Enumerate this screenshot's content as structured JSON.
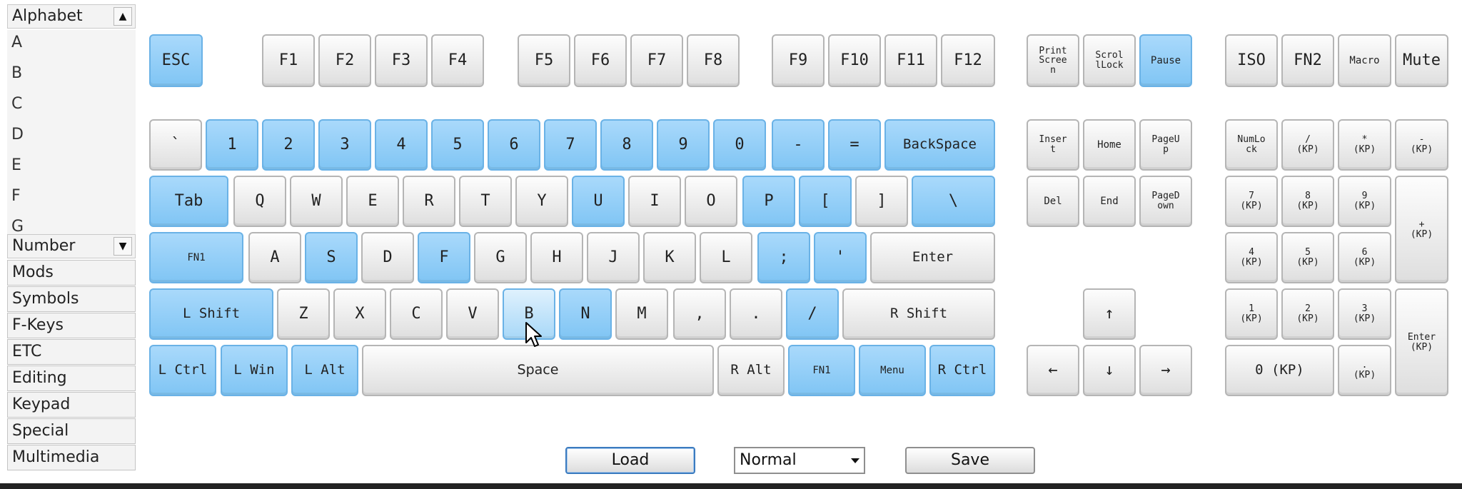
{
  "categories": {
    "alphabet_header": "Alphabet",
    "alphabet_items": [
      "A",
      "B",
      "C",
      "D",
      "E",
      "F",
      "G"
    ],
    "number_header": "Number",
    "items": [
      "Mods",
      "Symbols",
      "F-Keys",
      "ETC",
      "Editing",
      "Keypad",
      "Special",
      "Multimedia"
    ]
  },
  "keys": {
    "esc": "ESC",
    "f1": "F1",
    "f2": "F2",
    "f3": "F3",
    "f4": "F4",
    "f5": "F5",
    "f6": "F6",
    "f7": "F7",
    "f8": "F8",
    "f9": "F9",
    "f10": "F10",
    "f11": "F11",
    "f12": "F12",
    "printscreen": "Print\nScree\nn",
    "scrolllock": "Scrol\nlLock",
    "pause": "Pause",
    "iso": "ISO",
    "fn2": "FN2",
    "macro": "Macro",
    "mute": "Mute",
    "backtick": "`",
    "n1": "1",
    "n2": "2",
    "n3": "3",
    "n4": "4",
    "n5": "5",
    "n6": "6",
    "n7": "7",
    "n8": "8",
    "n9": "9",
    "n0": "0",
    "minus": "-",
    "equal": "=",
    "backspace": "BackSpace",
    "insert": "Inser\nt",
    "home": "Home",
    "pageup": "PageU\np",
    "numlock": "NumLo\nck",
    "kp_div": "/\n(KP)",
    "kp_mul": "*\n(KP)",
    "kp_sub": "-\n(KP)",
    "tab": "Tab",
    "q": "Q",
    "w": "W",
    "e": "E",
    "r": "R",
    "t": "T",
    "y": "Y",
    "u": "U",
    "i": "I",
    "o": "O",
    "p": "P",
    "lbracket": "[",
    "rbracket": "]",
    "backslash": "\\",
    "delete": "Del",
    "end": "End",
    "pagedown": "PageD\nown",
    "kp7": "7\n(KP)",
    "kp8": "8\n(KP)",
    "kp9": "9\n(KP)",
    "kp_add": "+\n(KP)",
    "fn1_left": "FN1",
    "a": "A",
    "s": "S",
    "d": "D",
    "f": "F",
    "g": "G",
    "h": "H",
    "j": "J",
    "k": "K",
    "l": "L",
    "semicolon": ";",
    "quote": "'",
    "enter": "Enter",
    "kp4": "4\n(KP)",
    "kp5": "5\n(KP)",
    "kp6": "6\n(KP)",
    "lshift": "L Shift",
    "z": "Z",
    "x": "X",
    "c": "C",
    "v": "V",
    "b": "B",
    "n": "N",
    "m": "M",
    "comma": ",",
    "period": ".",
    "slash": "/",
    "rshift": "R Shift",
    "up": "↑",
    "kp1": "1\n(KP)",
    "kp2": "2\n(KP)",
    "kp3": "3\n(KP)",
    "kp_enter": "Enter\n(KP)",
    "lctrl": "L Ctrl",
    "lwin": "L Win",
    "lalt": "L Alt",
    "space": "Space",
    "ralt": "R Alt",
    "fn1_right": "FN1",
    "menu": "Menu",
    "rctrl": "R Ctrl",
    "left": "←",
    "down": "↓",
    "right": "→",
    "kp0": "0 (KP)",
    "kp_dot": ".\n(KP)"
  },
  "controls": {
    "load_label": "Load",
    "mode_value": "Normal",
    "save_label": "Save"
  },
  "colors": {
    "assigned_key": "#89c9f6",
    "default_key": "#e8e8e8"
  }
}
